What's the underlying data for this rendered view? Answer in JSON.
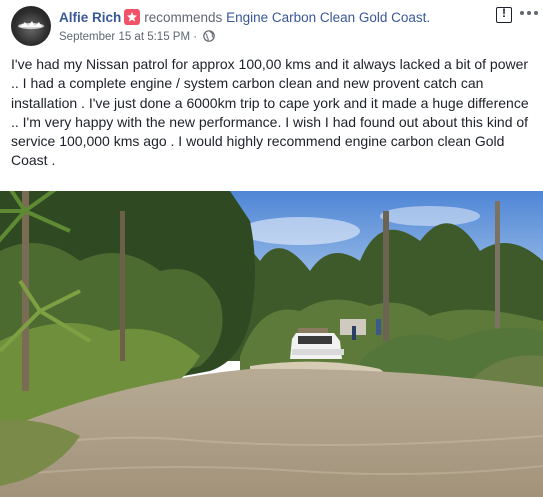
{
  "post": {
    "author_name": "Alfie Rich",
    "action_text": "recommends",
    "page_name": "Engine Carbon Clean Gold Coast.",
    "timestamp": "September 15 at 5:15 PM",
    "separator": "·",
    "privacy_icon": "globe-icon",
    "badge_icon": "recommendation-star-icon",
    "body": "I've had my Nissan patrol for approx 100,00 kms and it always lacked a bit of power .. I had a complete engine / system carbon clean and new provent catch can installation . I've just done a 6000km trip to cape york and it made a huge difference .. I'm very happy with the new performance. I wish I had found out about this kind of service 100,000 kms ago . I would highly recommend engine carbon clean Gold Coast ."
  },
  "icons": {
    "report": "report-exclamation-icon",
    "more": "more-options-icon"
  },
  "colors": {
    "link_blue": "#385898",
    "badge_pink": "#f25268",
    "text_dark": "#1d2129",
    "text_grey": "#606770"
  }
}
